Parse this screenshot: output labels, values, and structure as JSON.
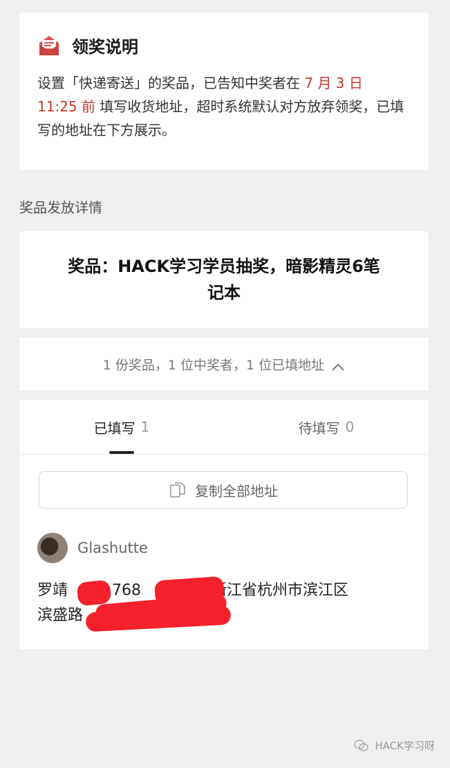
{
  "notice": {
    "title": "领奖说明",
    "body_pre": "设置「快递寄送」的奖品，已告知中奖者在 ",
    "deadline_date": "7 月 3 日",
    "deadline_time": "11:25 前",
    "body_post": " 填写收货地址，超时系统默认对方放弃领奖，已填写的地址在下方展示。",
    "icon": "mail-icon",
    "accent_color": "#c0392b"
  },
  "section_label": "奖品发放详情",
  "prize": {
    "title": "奖品：HACK学习学员抽奖，暗影精灵6笔记本"
  },
  "summary": {
    "text": "1 份奖品，1 位中奖者，1 位已填地址",
    "icon": "chevron-up-icon"
  },
  "tabs": [
    {
      "label": "已填写",
      "count": "1",
      "active": true
    },
    {
      "label": "待填写",
      "count": "0",
      "active": false
    }
  ],
  "copy_button": {
    "label": "复制全部地址",
    "icon": "copy-icon"
  },
  "winner": {
    "name": "Glashutte",
    "address_part1": "罗靖",
    "address_part2": "1768",
    "address_part3": "，浙江省杭州市滨江区",
    "address_line2": "滨盛路"
  },
  "watermark": {
    "text": "HACK学习呀",
    "icon": "wechat-icon"
  }
}
